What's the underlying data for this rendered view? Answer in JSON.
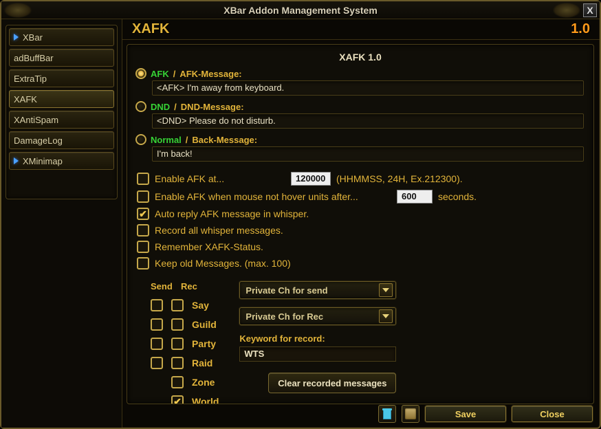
{
  "window": {
    "title": "XBar Addon Management System"
  },
  "sidebar": {
    "items": [
      {
        "label": "XBar",
        "arrow": true,
        "selected": false
      },
      {
        "label": "adBuffBar",
        "arrow": false,
        "selected": false
      },
      {
        "label": "ExtraTip",
        "arrow": false,
        "selected": false
      },
      {
        "label": "XAFK",
        "arrow": false,
        "selected": true
      },
      {
        "label": "XAntiSpam",
        "arrow": false,
        "selected": false
      },
      {
        "label": "DamageLog",
        "arrow": false,
        "selected": false
      },
      {
        "label": "XMinimap",
        "arrow": true,
        "selected": false
      }
    ]
  },
  "header": {
    "addon_name": "XAFK",
    "addon_version": "1.0"
  },
  "content_title": "XAFK 1.0",
  "status": {
    "afk": {
      "mode_label": "AFK",
      "msg_label": "AFK-Message:",
      "value": "<AFK> I'm away from keyboard.",
      "selected": true
    },
    "dnd": {
      "mode_label": "DND",
      "msg_label": "DND-Message:",
      "value": "<DND> Please do not disturb.",
      "selected": false
    },
    "normal": {
      "mode_label": "Normal",
      "msg_label": "Back-Message:",
      "value": "I'm back!",
      "selected": false
    }
  },
  "opts": {
    "enable_at": {
      "label": "Enable AFK at...",
      "value": "120000",
      "hint": "(HHMMSS, 24H, Ex.212300).",
      "checked": false
    },
    "enable_hover": {
      "label_pre": "Enable AFK when mouse not hover units after...",
      "value": "600",
      "label_post": "seconds.",
      "checked": false
    },
    "auto_reply": {
      "label": "Auto reply AFK message in whisper.",
      "checked": true
    },
    "record_whisper": {
      "label": "Record all whisper messages.",
      "checked": false
    },
    "remember": {
      "label": "Remember XAFK-Status.",
      "checked": false
    },
    "keep_old": {
      "label": "Keep old Messages. (max. 100)",
      "checked": false
    }
  },
  "channels": {
    "head_send": "Send",
    "head_rec": "Rec",
    "rows": [
      {
        "name": "Say",
        "send": false,
        "rec": false,
        "has_send": true
      },
      {
        "name": "Guild",
        "send": false,
        "rec": false,
        "has_send": true
      },
      {
        "name": "Party",
        "send": false,
        "rec": false,
        "has_send": true
      },
      {
        "name": "Raid",
        "send": false,
        "rec": false,
        "has_send": true
      },
      {
        "name": "Zone",
        "send": false,
        "rec": false,
        "has_send": false
      },
      {
        "name": "World",
        "send": false,
        "rec": true,
        "has_send": false
      }
    ]
  },
  "dropdowns": {
    "send": "Private Ch for send",
    "rec": "Private Ch for Rec"
  },
  "keyword": {
    "label": "Keyword for record:",
    "value": "WTS"
  },
  "buttons": {
    "clear": "Clear recorded messages",
    "save": "Save",
    "close": "Close"
  }
}
